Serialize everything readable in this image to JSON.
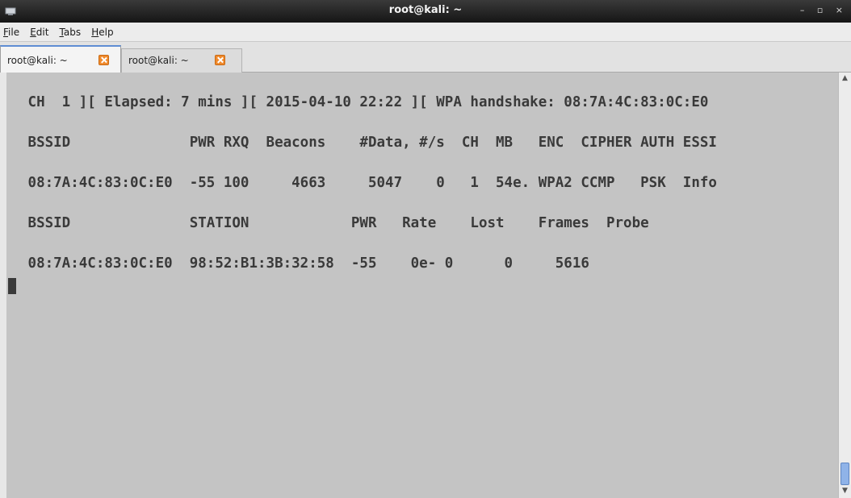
{
  "window": {
    "title": "root@kali: ~",
    "buttons": {
      "minimize": "–",
      "maximize": "▫",
      "close": "×"
    }
  },
  "menu": {
    "items": [
      {
        "label": "File",
        "mnemonic": "F",
        "rest": "ile"
      },
      {
        "label": "Edit",
        "mnemonic": "E",
        "rest": "dit"
      },
      {
        "label": "Tabs",
        "mnemonic": "T",
        "rest": "abs"
      },
      {
        "label": "Help",
        "mnemonic": "H",
        "rest": "elp"
      }
    ]
  },
  "tabs": [
    {
      "label": "root@kali: ~",
      "active": true
    },
    {
      "label": "root@kali: ~",
      "active": false
    }
  ],
  "terminal": {
    "lines": [
      " CH  1 ][ Elapsed: 7 mins ][ 2015-04-10 22:22 ][ WPA handshake: 08:7A:4C:83:0C:E0",
      " BSSID              PWR RXQ  Beacons    #Data, #/s  CH  MB   ENC  CIPHER AUTH ESSI",
      " 08:7A:4C:83:0C:E0  -55 100     4663     5047    0   1  54e. WPA2 CCMP   PSK  Info",
      " BSSID              STATION            PWR   Rate    Lost    Frames  Probe",
      " 08:7A:4C:83:0C:E0  98:52:B1:3B:32:58  -55    0e- 0      0     5616"
    ]
  },
  "colors": {
    "terminal_bg": "#c4c4c4",
    "terminal_fg": "#3a3a3a",
    "titlebar": "#1e1e1e",
    "tab_close": "#f08a2c",
    "scroll_thumb": "#8fb3e8"
  }
}
